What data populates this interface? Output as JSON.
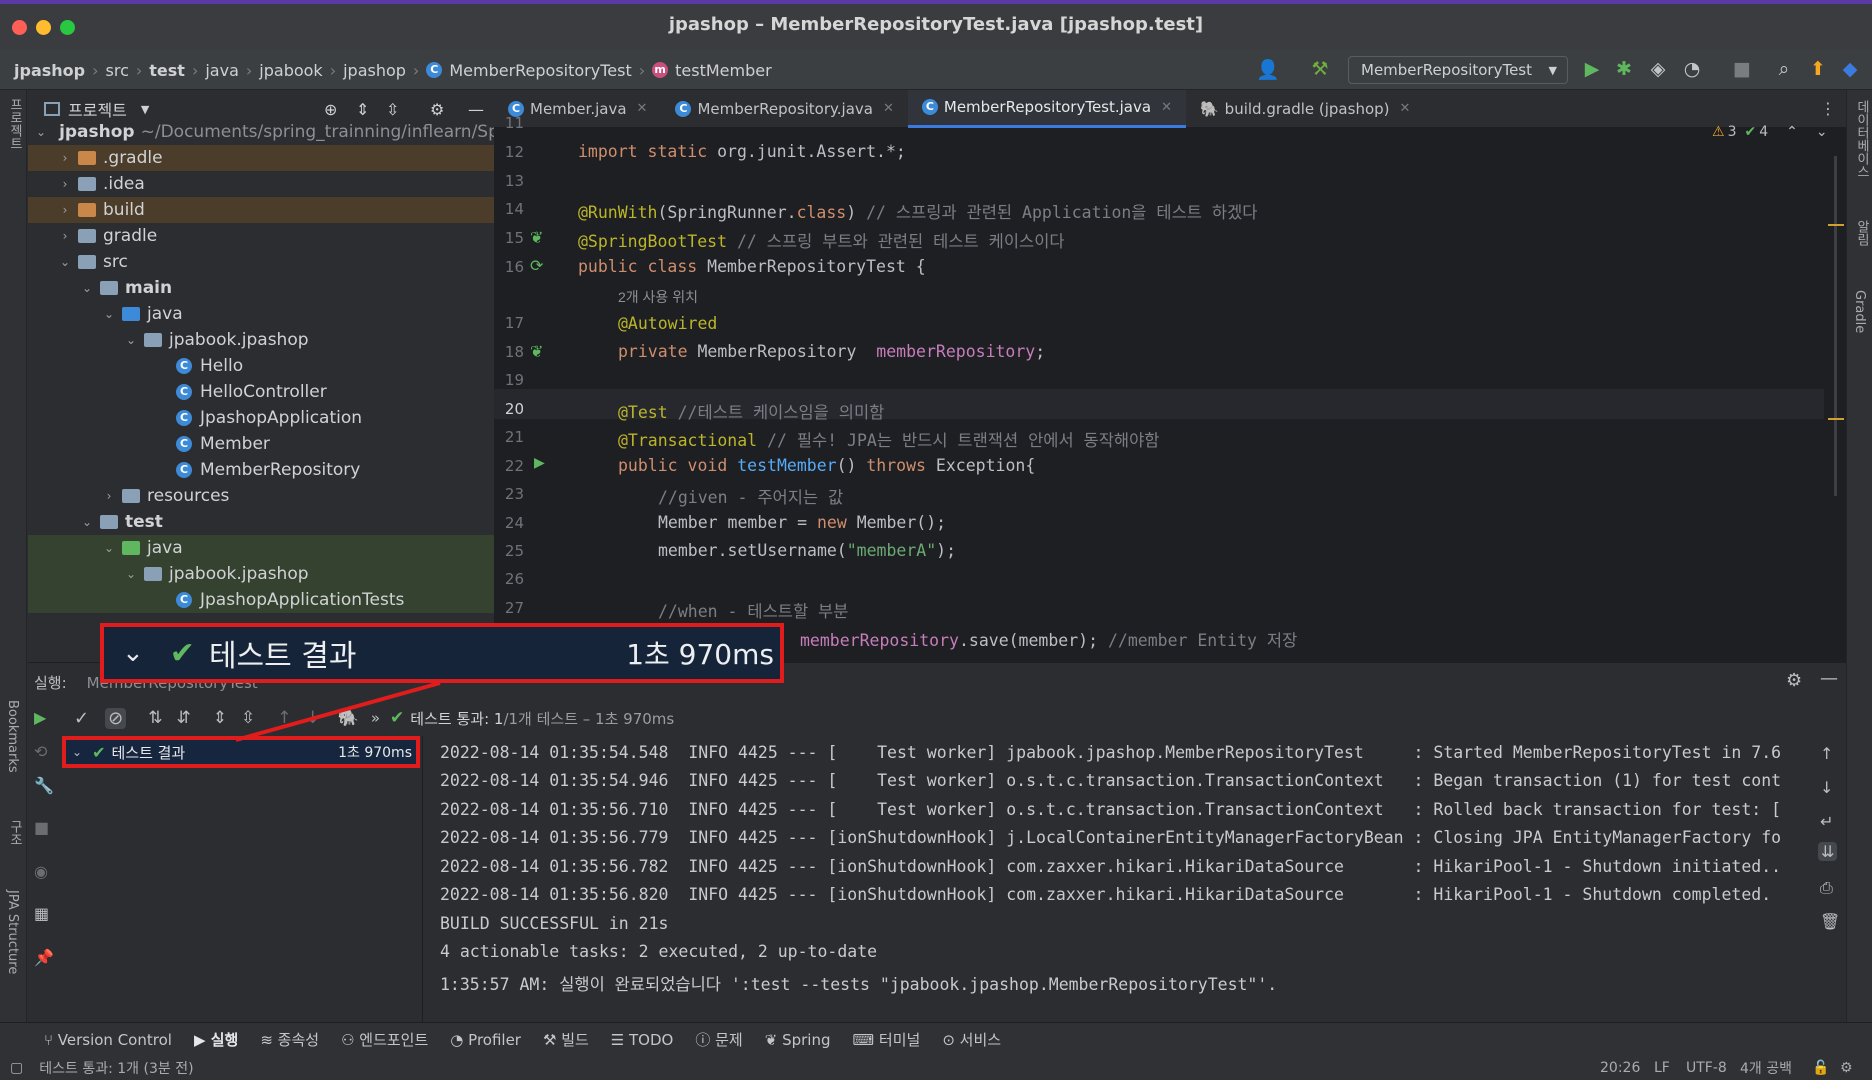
{
  "window": {
    "title": "jpashop – MemberRepositoryTest.java [jpashop.test]"
  },
  "breadcrumb": [
    "jpashop",
    "src",
    "test",
    "java",
    "jpabook",
    "jpashop",
    "MemberRepositoryTest",
    "testMember"
  ],
  "toolbar": {
    "run_config": "MemberRepositoryTest"
  },
  "project": {
    "header": "프로젝트",
    "root": "jpashop",
    "root_path": "~/Documents/spring_trainning/inflearn/Sp",
    "items": [
      {
        "label": ".gradle"
      },
      {
        "label": ".idea"
      },
      {
        "label": "build"
      },
      {
        "label": "gradle"
      },
      {
        "label": "src"
      },
      {
        "label": "main"
      },
      {
        "label": "java"
      },
      {
        "label": "jpabook.jpashop"
      },
      {
        "label": "Hello"
      },
      {
        "label": "HelloController"
      },
      {
        "label": "JpashopApplication"
      },
      {
        "label": "Member"
      },
      {
        "label": "MemberRepository"
      },
      {
        "label": "resources"
      },
      {
        "label": "test"
      },
      {
        "label": "java"
      },
      {
        "label": "jpabook.jpashop"
      },
      {
        "label": "JpashopApplicationTests"
      }
    ]
  },
  "tabs": [
    {
      "label": "Member.java"
    },
    {
      "label": "MemberRepository.java"
    },
    {
      "label": "MemberRepositoryTest.java"
    },
    {
      "label": "build.gradle (jpashop)"
    }
  ],
  "editor": {
    "warnings": "3",
    "checks": "4",
    "line_numbers": [
      "11",
      "12",
      "13",
      "14",
      "15",
      "16",
      "",
      "17",
      "18",
      "19",
      "20",
      "21",
      "22",
      "23",
      "24",
      "25",
      "26",
      "27"
    ],
    "usage_hint": "2개 사용 위치"
  },
  "run": {
    "label": "실행:",
    "config": "MemberRepositoryTest",
    "status": "테스트 통과: 1",
    "status_detail": "/1개 테스트 – 1초 970ms",
    "tree_root": "테스트 결과",
    "tree_time": "1초 970ms",
    "zoom_label": "테스트 결과",
    "zoom_time": "1초 970ms",
    "console": [
      "2022-08-14 01:35:54.548  INFO 4425 --- [    Test worker] jpabook.jpashop.MemberRepositoryTest     : Started MemberRepositoryTest in 7.6",
      "2022-08-14 01:35:54.946  INFO 4425 --- [    Test worker] o.s.t.c.transaction.TransactionContext   : Began transaction (1) for test cont",
      "2022-08-14 01:35:56.710  INFO 4425 --- [    Test worker] o.s.t.c.transaction.TransactionContext   : Rolled back transaction for test: [",
      "2022-08-14 01:35:56.779  INFO 4425 --- [ionShutdownHook] j.LocalContainerEntityManagerFactoryBean : Closing JPA EntityManagerFactory fo",
      "2022-08-14 01:35:56.782  INFO 4425 --- [ionShutdownHook] com.zaxxer.hikari.HikariDataSource       : HikariPool-1 - Shutdown initiated..",
      "2022-08-14 01:35:56.820  INFO 4425 --- [ionShutdownHook] com.zaxxer.hikari.HikariDataSource       : HikariPool-1 - Shutdown completed.",
      "BUILD SUCCESSFUL in 21s",
      "4 actionable tasks: 2 executed, 2 up-to-date",
      "1:35:57 AM: 실행이 완료되었습니다 ':test --tests \"jpabook.jpashop.MemberRepositoryTest\"'."
    ]
  },
  "bottom_tabs": [
    "Version Control",
    "실행",
    "종속성",
    "엔드포인트",
    "Profiler",
    "빌드",
    "TODO",
    "문제",
    "Spring",
    "터미널",
    "서비스"
  ],
  "status_bar": {
    "message": "테스트 통과: 1개 (3분 전)",
    "position": "20:26",
    "line_sep": "LF",
    "encoding": "UTF-8",
    "indent": "4개 공백"
  },
  "side_labels": {
    "left_top": "프로젝트",
    "left_bookmarks": "Bookmarks",
    "left_structure": "구조",
    "left_jpa": "JPA Structure",
    "right_db": "데이터베이스",
    "right_notice": "알림",
    "right_gradle": "Gradle"
  },
  "colors": {
    "accent": "#3b7be0",
    "highlight_red": "#e11c1c",
    "pass_green": "#5fb85f"
  }
}
